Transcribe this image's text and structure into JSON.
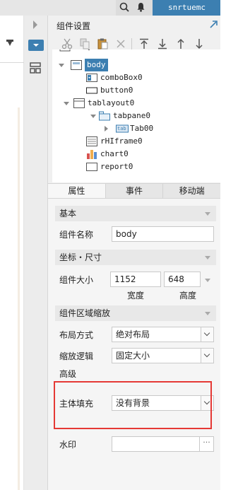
{
  "topbar": {
    "username": "snrtuemc"
  },
  "panel": {
    "title": "组件设置"
  },
  "tree": {
    "partial_top": "body",
    "nodes": [
      {
        "label": "body",
        "icon": "form-icon"
      },
      {
        "label": "comboBox0",
        "icon": "combobox-icon"
      },
      {
        "label": "button0",
        "icon": "button-icon"
      },
      {
        "label": "tablayout0",
        "icon": "tablayout-icon"
      },
      {
        "label": "tabpane0",
        "icon": "tabpane-icon"
      },
      {
        "label": "Tab00",
        "icon": "tab-icon"
      },
      {
        "label": "rHIframe0",
        "icon": "iframe-icon"
      },
      {
        "label": "chart0",
        "icon": "chart-icon"
      },
      {
        "label": "report0",
        "icon": "report-icon"
      }
    ],
    "tab_icon_text": "tab"
  },
  "tabs": [
    {
      "label": "属性",
      "active": true
    },
    {
      "label": "事件",
      "active": false
    },
    {
      "label": "移动端",
      "active": false
    }
  ],
  "props": {
    "basic": {
      "header": "基本",
      "name_label": "组件名称",
      "name_value": "body"
    },
    "coords": {
      "header": "坐标・尺寸",
      "size_label": "组件大小",
      "width_value": "1152",
      "height_value": "648",
      "width_label": "宽度",
      "height_label": "高度"
    },
    "scale": {
      "header": "组件区域缩放",
      "layout_label": "布局方式",
      "layout_value": "绝对布局",
      "scale_label": "缩放逻辑",
      "scale_value": "固定大小"
    },
    "advanced": {
      "header": "高级",
      "fill_label": "主体填充",
      "fill_value": "没有背景",
      "watermark_label": "水印",
      "watermark_value": "",
      "watermark_btn": "···"
    }
  },
  "colors": {
    "accent": "#3c7fb1",
    "highlight": "#e53935"
  }
}
